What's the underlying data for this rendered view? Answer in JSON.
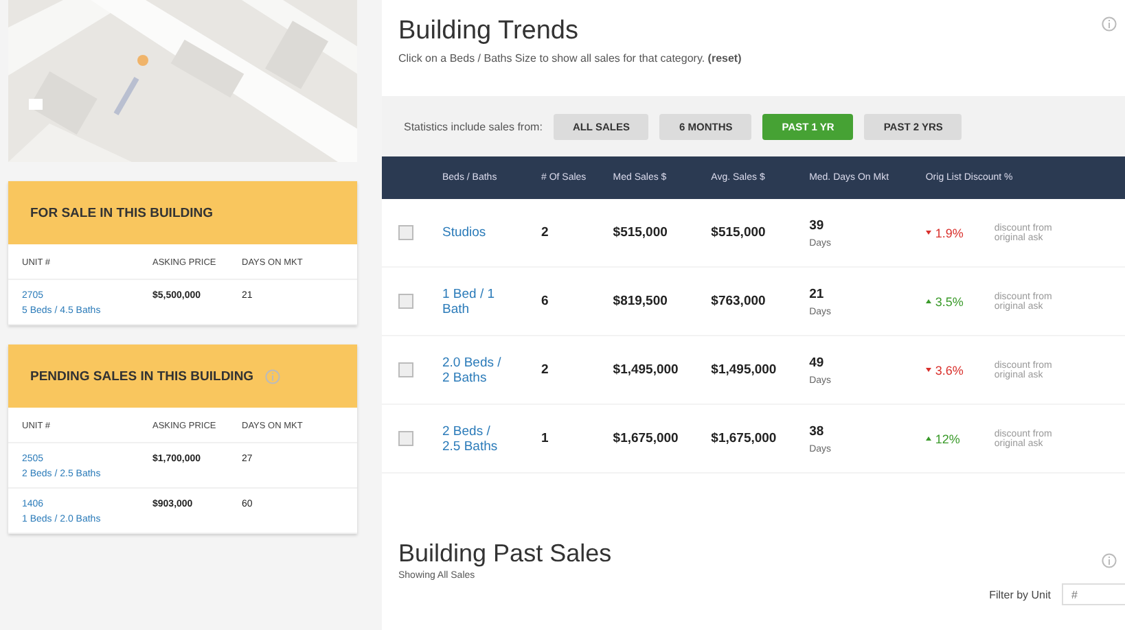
{
  "listing_cards": [
    {
      "title": "FOR SALE IN THIS BUILDING",
      "info_icon": false,
      "columns": [
        "UNIT #",
        "ASKING PRICE",
        "DAYS ON MKT"
      ],
      "rows": [
        {
          "unit": "2705",
          "beds_baths": "5 Beds / 4.5 Baths",
          "price": "$5,500,000",
          "days": "21"
        }
      ]
    },
    {
      "title": "PENDING SALES IN THIS BUILDING",
      "info_icon": true,
      "columns": [
        "UNIT #",
        "ASKING PRICE",
        "DAYS ON MKT"
      ],
      "rows": [
        {
          "unit": "2505",
          "beds_baths": "2 Beds / 2.5 Baths",
          "price": "$1,700,000",
          "days": "27"
        },
        {
          "unit": "1406",
          "beds_baths": "1 Beds / 2.0 Baths",
          "price": "$903,000",
          "days": "60"
        }
      ]
    }
  ],
  "trends": {
    "title": "Building Trends",
    "subtitle": "Click on a Beds / Baths Size to show all sales for that category. **(reset)**",
    "filter_label": "Statistics include sales from:",
    "filters": [
      {
        "label": "ALL SALES",
        "selected": false
      },
      {
        "label": "6 MONTHS",
        "selected": false
      },
      {
        "label": "PAST 1 YR",
        "selected": true
      },
      {
        "label": "PAST 2 YRS",
        "selected": false
      }
    ],
    "columns": [
      "Beds / Baths",
      "# Of Sales",
      "Med Sales $",
      "Avg. Sales $",
      "Med. Days On Mkt",
      "Orig List Discount %"
    ],
    "rows": [
      {
        "checked": false,
        "beds_baths": "Studios",
        "sales": "2",
        "median": "$515,000",
        "average": "$515,000",
        "days": "39",
        "days_unit": "Days",
        "negative": true,
        "discount": "1.9%",
        "note": "discount from original ask"
      },
      {
        "checked": false,
        "beds_baths": "1 Bed / 1 Bath",
        "sales": "6",
        "median": "$819,500",
        "average": "$763,000",
        "days": "21",
        "days_unit": "Days",
        "negative": false,
        "discount": "3.5%",
        "note": "discount from original ask"
      },
      {
        "checked": false,
        "beds_baths": "2.0 Beds / 2 Baths",
        "sales": "2",
        "median": "$1,495,000",
        "average": "$1,495,000",
        "days": "49",
        "days_unit": "Days",
        "negative": true,
        "discount": "3.6%",
        "note": "discount from original ask"
      },
      {
        "checked": false,
        "beds_baths": "2 Beds / 2.5 Baths",
        "sales": "1",
        "median": "$1,675,000",
        "average": "$1,675,000",
        "days": "38",
        "days_unit": "Days",
        "negative": false,
        "discount": "12%",
        "note": "discount from original ask"
      }
    ]
  },
  "past_sales": {
    "title": "Building Past Sales",
    "subtitle": "Showing All Sales",
    "filter_label": "Filter by Unit",
    "filter_placeholder": "#"
  }
}
